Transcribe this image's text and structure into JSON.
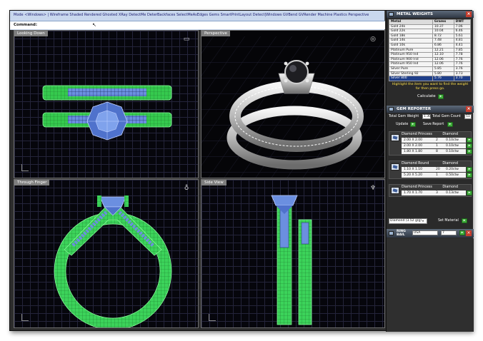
{
  "menu_bar": {
    "text": "Mode <Windows> | Wireframe Shaded Rendered Ghosted XRay DetectMe DeterBackfaces SelectMeAsEdges Gems SmartPrintLayout Detect|Windows GVBend GVRender Machine Plastics Perspective"
  },
  "command": {
    "label": "Command:"
  },
  "viewports": [
    {
      "title": "Looking Down"
    },
    {
      "title": "Perspective"
    },
    {
      "title": "Through Finger"
    },
    {
      "title": "Side View"
    }
  ],
  "metal_weights": {
    "title": "METAL WEIGHTS",
    "columns": [
      "Metal",
      "Grams",
      "DWT"
    ],
    "rows": [
      [
        "Gold 24k",
        "10.37",
        "7.06"
      ],
      [
        "Gold 22k",
        "10.04",
        "6.46"
      ],
      [
        "Gold 18k",
        "8.72",
        "5.61"
      ],
      [
        "Gold 14k",
        "7.48",
        "4.81"
      ],
      [
        "Gold 10k",
        "6.86",
        "4.41"
      ],
      [
        "Platinum Pure",
        "12.21",
        "7.85"
      ],
      [
        "Platinum 950 Ind",
        "12.10",
        "7.78"
      ],
      [
        "Platinum 900 Irid",
        "12.06",
        "7.76"
      ],
      [
        "Platinum 950 Ind",
        "12.06",
        "7.76"
      ],
      [
        "Silver Pure",
        "5.85",
        "3.76"
      ],
      [
        "Silver Sterling 92",
        "5.80",
        "3.73"
      ],
      [
        "Silver 800",
        "5.76",
        "3.70"
      ]
    ],
    "selected_row": 11,
    "hint": "Highlight the item you want to find the weight for then press go.",
    "calculate_label": "Calculate"
  },
  "gem_reporter": {
    "title": "GEM REPORTER",
    "total_weight_label": "Total Gem Weight",
    "total_weight_value": "1.30",
    "total_count_label": "Total Gem Count",
    "total_count_value": "51",
    "update_label": "Update",
    "save_label": "Save Report",
    "gems": [
      {
        "name": "Diamond Princess",
        "shape": "Diamond",
        "rows": [
          [
            "2.00 X 2.00",
            "2",
            "0.10ctw"
          ],
          [
            "2.00 X 2.00",
            "1",
            "0.10ctw"
          ],
          [
            "1.80 X 1.80",
            "8",
            "0.10ctw"
          ]
        ]
      },
      {
        "name": "Diamond Round",
        "shape": "Diamond",
        "rows": [
          [
            "1.10 X 1.10",
            "20",
            "0.20ctw"
          ],
          [
            "5.20 X 5.20",
            "1",
            "0.50ctw"
          ]
        ]
      },
      {
        "name": "Diamond Princess",
        "shape": "Diamond",
        "rows": [
          [
            "1.70 X 1.70",
            "3",
            "0.13ctw"
          ]
        ]
      }
    ],
    "dropdown_value": "Diamond (3.52 g/g)",
    "set_material_label": "Set Material"
  },
  "ring_bail": {
    "label_line1": "RING",
    "label_line2": "BAIL",
    "country": "USA",
    "size": "7"
  },
  "colors": {
    "mesh_green": "#5cf07a",
    "gem_blue": "#6b8fe0",
    "metal_silver": "#d8d8d8",
    "highlight_yellow": "#ffe14a",
    "button_green": "#3fae3a"
  }
}
